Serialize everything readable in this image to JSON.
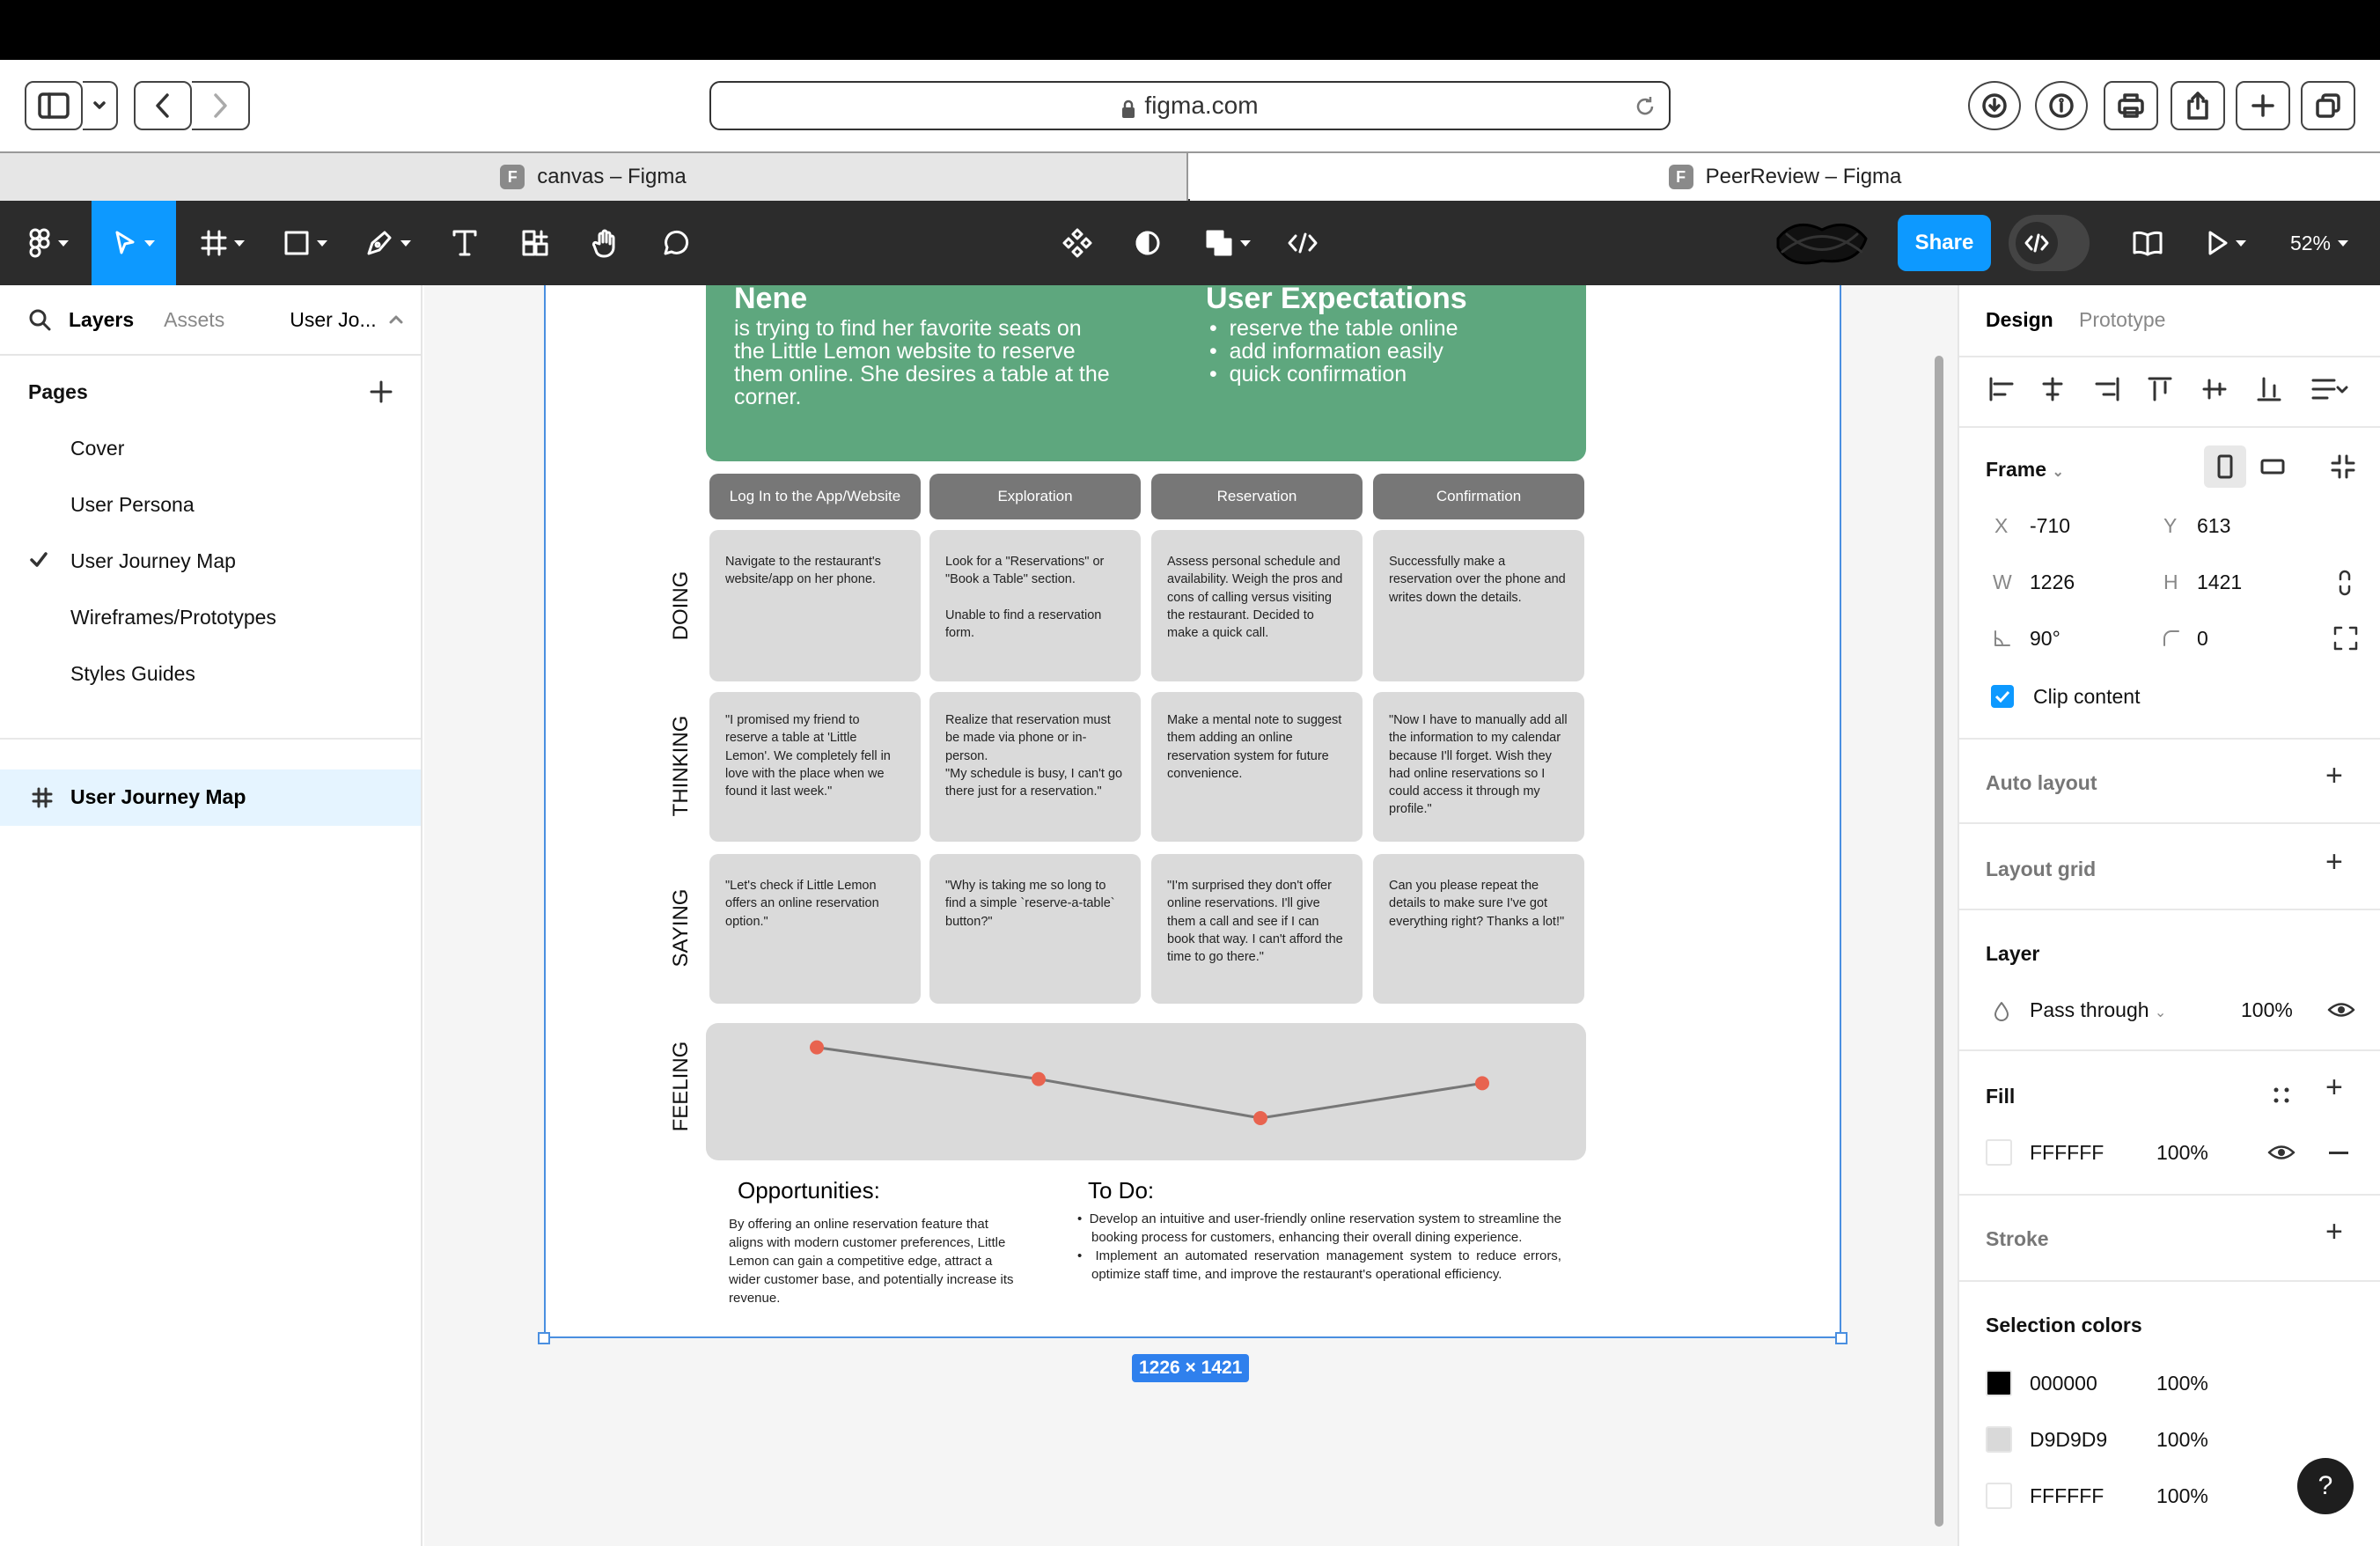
{
  "browser": {
    "url": "figma.com",
    "tabs": [
      {
        "label": "canvas – Figma",
        "active": false,
        "favicon": "F"
      },
      {
        "label": "PeerReview – Figma",
        "active": true,
        "favicon": "F"
      }
    ]
  },
  "toolbar": {
    "share_label": "Share",
    "zoom": "52%"
  },
  "left_panel": {
    "tabs": [
      "Layers",
      "Assets"
    ],
    "current_page_short": "User Jo...",
    "pages_title": "Pages",
    "pages": [
      "Cover",
      "User Persona",
      "User Journey Map",
      "Wireframes/Prototypes",
      "Styles Guides"
    ],
    "selected_page": "User Journey Map",
    "layer": "User Journey Map"
  },
  "journey": {
    "persona_name": "Nene",
    "persona_desc": "is trying to find her favorite seats on the Little Lemon website to reserve them online. She desires a table at the corner.",
    "expect_title": "User Expectations",
    "expectations": [
      "reserve the table online",
      "add information easily",
      "quick confirmation"
    ],
    "stages": [
      "Log In to the App/Website",
      "Exploration",
      "Reservation",
      "Confirmation"
    ],
    "rows": [
      "DOING",
      "THINKING",
      "SAYING",
      "FEELING"
    ],
    "doing": [
      "Navigate to the restaurant's website/app on her phone.",
      "Look for a \"Reservations\" or \"Book a Table\" section.\n\nUnable to find a reservation form.",
      "Assess personal schedule and availability. Weigh the pros and cons of calling versus visiting the restaurant. Decided to make a quick call.",
      "Successfully make a reservation over the phone and writes down the details."
    ],
    "thinking": [
      "\"I promised my friend to reserve a table at 'Little Lemon'. We completely fell in love with the place when we found it last week.\"",
      "Realize that reservation must be made via phone or in-person.\n\"My schedule is busy, I can't go there just for a reservation.\"",
      "Make a mental note to suggest them adding an online reservation system for future convenience.",
      "\"Now I have to manually add all the information to my calendar because I'll forget. Wish they had online reservations so I could access it through my profile.\""
    ],
    "saying": [
      "\"Let's check if Little Lemon offers an online reservation option.\"",
      "\"Why is taking me so long to find a simple `reserve-a-table` button?\"",
      "\"I'm surprised they don't offer online reservations. I'll give them a call and see if I can book that way. I can't afford the time to go there.\"",
      "Can you please repeat the details to make sure I've got everything right? Thanks a lot!\""
    ],
    "feeling_levels": [
      0.92,
      0.62,
      0.25,
      0.58
    ],
    "opp_title": "Opportunities:",
    "opp_text": "By offering an online reservation feature that aligns with modern customer preferences, Little Lemon can gain a competitive edge, attract a wider customer base, and potentially increase its revenue.",
    "todo_title": "To Do:",
    "todo_items": [
      "Develop an intuitive and user-friendly online reservation system to streamline the booking process for customers, enhancing their overall dining experience.",
      "Implement an automated reservation management system to reduce errors, optimize staff time, and improve the restaurant's operational efficiency."
    ],
    "dimensions": "1226 × 1421"
  },
  "right_panel": {
    "tabs": [
      "Design",
      "Prototype"
    ],
    "frame_label": "Frame",
    "x_label": "X",
    "x": "-710",
    "y_label": "Y",
    "y": "613",
    "w_label": "W",
    "w": "1226",
    "h_label": "H",
    "h": "1421",
    "rotation": "90°",
    "radius": "0",
    "clip_label": "Clip content",
    "auto_layout": "Auto layout",
    "layout_grid": "Layout grid",
    "layer_title": "Layer",
    "blend": "Pass through",
    "layer_opacity": "100%",
    "fill_title": "Fill",
    "fill_hex": "FFFFFF",
    "fill_opacity": "100%",
    "stroke_title": "Stroke",
    "selection_title": "Selection colors",
    "selection_colors": [
      {
        "hex": "000000",
        "opacity": "100%",
        "color": "#000000"
      },
      {
        "hex": "D9D9D9",
        "opacity": "100%",
        "color": "#D9D9D9"
      },
      {
        "hex": "FFFFFF",
        "opacity": "100%",
        "color": "#FFFFFF"
      }
    ],
    "help": "?"
  },
  "colors": {
    "accent": "#2f80ed",
    "header_green": "#5ea77e",
    "marker": "#e8634f"
  }
}
